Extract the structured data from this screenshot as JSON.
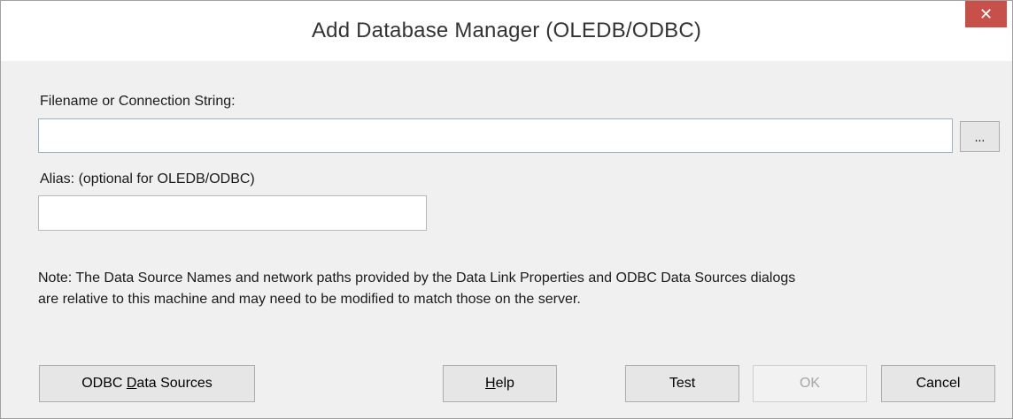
{
  "window": {
    "title": "Add Database Manager (OLEDB/ODBC)",
    "close_glyph": "✕",
    "close_icon": "close-icon"
  },
  "form": {
    "connection_label": "Filename or Connection String:",
    "connection_value": "",
    "browse_label": "...",
    "alias_label": "Alias: (optional for OLEDB/ODBC)",
    "alias_value": ""
  },
  "note": {
    "line1": "Note: The Data Source Names and network paths provided by the Data Link Properties and ODBC Data Sources dialogs",
    "line2": "are relative to this machine and may need to be modified to match those on the server."
  },
  "buttons": {
    "odbc_pre": "ODBC ",
    "odbc_accel": "D",
    "odbc_post": "ata Sources",
    "help_accel": "H",
    "help_post": "elp",
    "test": "Test",
    "ok": "OK",
    "cancel": "Cancel"
  },
  "colors": {
    "close_bg": "#c7504b",
    "focus_border": "#9ab3cf"
  }
}
